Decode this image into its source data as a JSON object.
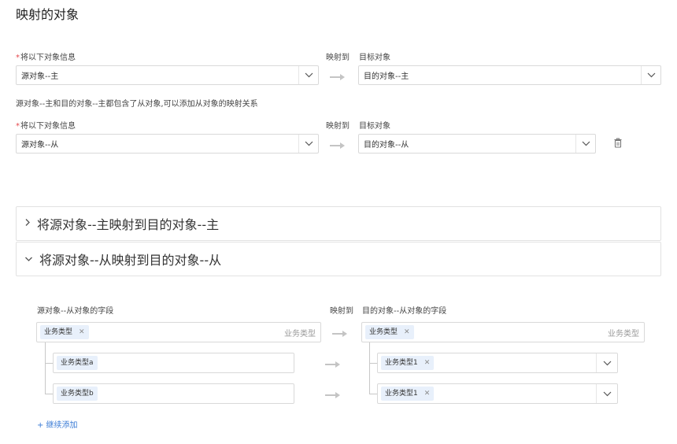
{
  "page": {
    "title": "映射的对象"
  },
  "mapping_rows": [
    {
      "source_label": "将以下对象信息",
      "map_label": "映射到",
      "target_label": "目标对象",
      "source_value": "源对象--主",
      "target_value": "目的对象--主"
    },
    {
      "source_label": "将以下对象信息",
      "map_label": "映射到",
      "target_label": "目标对象",
      "source_value": "源对象--从",
      "target_value": "目的对象--从"
    }
  ],
  "note": "源对象--主和目的对象--主都包含了从对象,可以添加从对象的映射关系",
  "panels": [
    {
      "title": "将源对象--主映射到目的对象--主",
      "expanded": false
    },
    {
      "title": "将源对象--从映射到目的对象--从",
      "expanded": true
    }
  ],
  "field_mapping": {
    "source_header": "源对象--从对象的字段",
    "map_header": "映射到",
    "target_header": "目的对象--从对象的字段",
    "root": {
      "source_tag": "业务类型",
      "source_placeholder": "业务类型",
      "target_tag": "业务类型",
      "target_placeholder": "业务类型"
    },
    "children": [
      {
        "source_tag": "业务类型a",
        "target_tag": "业务类型1"
      },
      {
        "source_tag": "业务类型b",
        "target_tag": "业务类型1"
      }
    ],
    "add_label": "+ 继续添加"
  },
  "icons": {
    "chevron": "chevron-down-icon",
    "arrow": "arrow-right-icon",
    "delete": "trash-icon",
    "collapse": "chevron-right-icon",
    "expand": "chevron-down-icon",
    "tag_close": "close-icon"
  },
  "colors": {
    "accent": "#3a7bd5",
    "tag_bg": "#e8f0fb",
    "required": "#e5484d"
  }
}
